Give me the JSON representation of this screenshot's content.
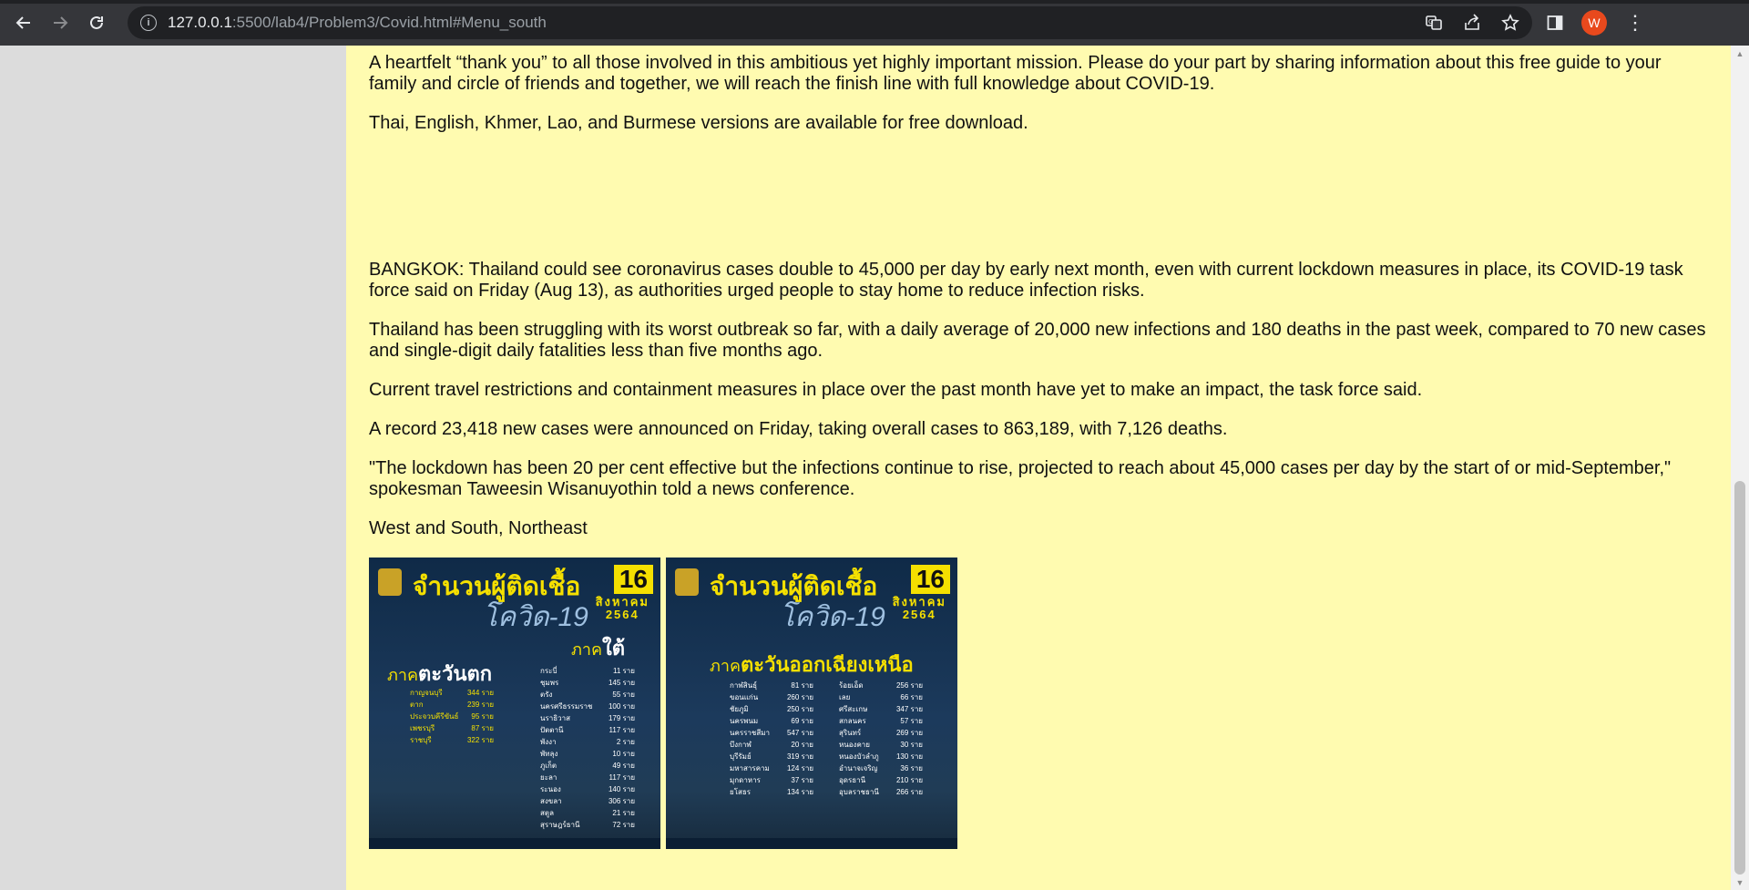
{
  "browser": {
    "url_host": "127.0.0.1",
    "url_path": ":5500/lab4/Problem3/Covid.html#Menu_south",
    "profile_initial": "W",
    "icons": [
      "back-arrow",
      "forward-arrow",
      "reload",
      "site-info",
      "translate",
      "share",
      "bookmark-star",
      "side-panel",
      "profile",
      "menu-kebab"
    ]
  },
  "article": {
    "paragraphs": [
      "A heartfelt “thank you” to all those involved in this ambitious yet highly important mission. Please do your part by sharing information about this free guide to your family and circle of friends and together, we will reach the finish line with full knowledge about COVID-19.",
      "Thai, English, Khmer, Lao, and Burmese versions are available for free download.",
      "BANGKOK: Thailand could see coronavirus cases double to 45,000 per day by early next month, even with current lockdown measures in place, its COVID-19 task force said on Friday (Aug 13), as authorities urged people to stay home to reduce infection risks.",
      "Thailand has been struggling with its worst outbreak so far, with a daily average of 20,000 new infections and 180 deaths in the past week, compared to 70 new cases and single-digit daily fatalities less than five months ago.",
      "Current travel restrictions and containment measures in place over the past month have yet to make an impact, the task force said.",
      "A record 23,418 new cases were announced on Friday, taking overall cases to 863,189, with 7,126 deaths.",
      "\"The lockdown has been 20 per cent effective but the infections continue to rise, projected to reach about 45,000 cases per day by the start of or mid-September,\" spokesman Taweesin Wisanuyothin told a news conference.",
      "West and South, Northeast"
    ]
  },
  "infographics": [
    {
      "title": "จำนวนผู้ติดเชื้อ",
      "subtitle": "โควิด-19",
      "day": "16",
      "month": "สิงหาคม",
      "year": "2564",
      "regions": [
        {
          "prefix": "ภาค",
          "name": "ตะวันตก",
          "rows": [
            [
              "กาญจนบุรี",
              "344 ราย"
            ],
            [
              "ตาก",
              "239 ราย"
            ],
            [
              "ประจวบคีรีขันธ์",
              "95 ราย"
            ],
            [
              "เพชรบุรี",
              "87 ราย"
            ],
            [
              "ราชบุรี",
              "322 ราย"
            ]
          ]
        },
        {
          "prefix": "ภาค",
          "name": "ใต้",
          "rows": [
            [
              "กระบี่",
              "11 ราย"
            ],
            [
              "ชุมพร",
              "145 ราย"
            ],
            [
              "ตรัง",
              "55 ราย"
            ],
            [
              "นครศรีธรรมราช",
              "100 ราย"
            ],
            [
              "นราธิวาส",
              "179 ราย"
            ],
            [
              "ปัตตานี",
              "117 ราย"
            ],
            [
              "พังงา",
              "2 ราย"
            ],
            [
              "พัทลุง",
              "10 ราย"
            ],
            [
              "ภูเก็ต",
              "49 ราย"
            ],
            [
              "ยะลา",
              "117 ราย"
            ],
            [
              "ระนอง",
              "140 ราย"
            ],
            [
              "สงขลา",
              "306 ราย"
            ],
            [
              "สตูล",
              "21 ราย"
            ],
            [
              "สุราษฎร์ธานี",
              "72 ราย"
            ]
          ]
        }
      ]
    },
    {
      "title": "จำนวนผู้ติดเชื้อ",
      "subtitle": "โควิด-19",
      "day": "16",
      "month": "สิงหาคม",
      "year": "2564",
      "regions": [
        {
          "prefix": "ภาค",
          "name": "ตะวันออกเฉียงเหนือ",
          "rows": [
            [
              "กาฬสินธุ์",
              "81 ราย"
            ],
            [
              "ขอนแก่น",
              "260 ราย"
            ],
            [
              "ชัยภูมิ",
              "250 ราย"
            ],
            [
              "นครพนม",
              "69 ราย"
            ],
            [
              "นครราชสีมา",
              "547 ราย"
            ],
            [
              "บึงกาฬ",
              "20 ราย"
            ],
            [
              "บุรีรัมย์",
              "319 ราย"
            ],
            [
              "มหาสารคาม",
              "124 ราย"
            ],
            [
              "มุกดาหาร",
              "37 ราย"
            ],
            [
              "ยโสธร",
              "134 ราย"
            ],
            [
              "ร้อยเอ็ด",
              "256 ราย"
            ],
            [
              "เลย",
              "66 ราย"
            ],
            [
              "ศรีสะเกษ",
              "347 ราย"
            ],
            [
              "สกลนคร",
              "57 ราย"
            ],
            [
              "สุรินทร์",
              "269 ราย"
            ],
            [
              "หนองคาย",
              "30 ราย"
            ],
            [
              "หนองบัวลำภู",
              "130 ราย"
            ],
            [
              "อำนาจเจริญ",
              "36 ราย"
            ],
            [
              "อุดรธานี",
              "210 ราย"
            ],
            [
              "อุบลราชธานี",
              "266 ราย"
            ]
          ]
        }
      ]
    }
  ]
}
